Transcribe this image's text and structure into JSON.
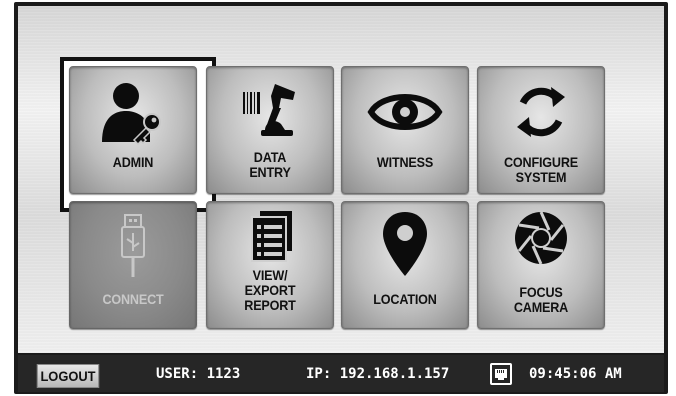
{
  "tiles": [
    {
      "label": "ADMIN",
      "icon": "admin-user-key-icon",
      "enabled": true,
      "selected": true
    },
    {
      "label": "DATA\nENTRY",
      "icon": "barcode-scanner-icon",
      "enabled": true,
      "selected": false
    },
    {
      "label": "WITNESS",
      "icon": "eye-icon",
      "enabled": true,
      "selected": false
    },
    {
      "label": "CONFIGURE\nSYSTEM",
      "icon": "refresh-cycle-icon",
      "enabled": true,
      "selected": false
    },
    {
      "label": "CONNECT",
      "icon": "usb-icon",
      "enabled": false,
      "selected": false
    },
    {
      "label": "VIEW/\nEXPORT\nREPORT",
      "icon": "report-list-icon",
      "enabled": true,
      "selected": false
    },
    {
      "label": "LOCATION",
      "icon": "map-pin-icon",
      "enabled": true,
      "selected": false
    },
    {
      "label": "FOCUS\nCAMERA",
      "icon": "camera-aperture-icon",
      "enabled": true,
      "selected": false
    }
  ],
  "status": {
    "logout_label": "LOGOUT",
    "user": "USER: 1123",
    "ip": "IP: 192.168.1.157",
    "network_icon": "ethernet-port-icon",
    "time": "09:45:06 AM"
  },
  "colors": {
    "statusbar_bg": "#262626",
    "tile_text": "#111111",
    "disabled_text": "#c8c8c8",
    "selection_frame": "#111111"
  }
}
